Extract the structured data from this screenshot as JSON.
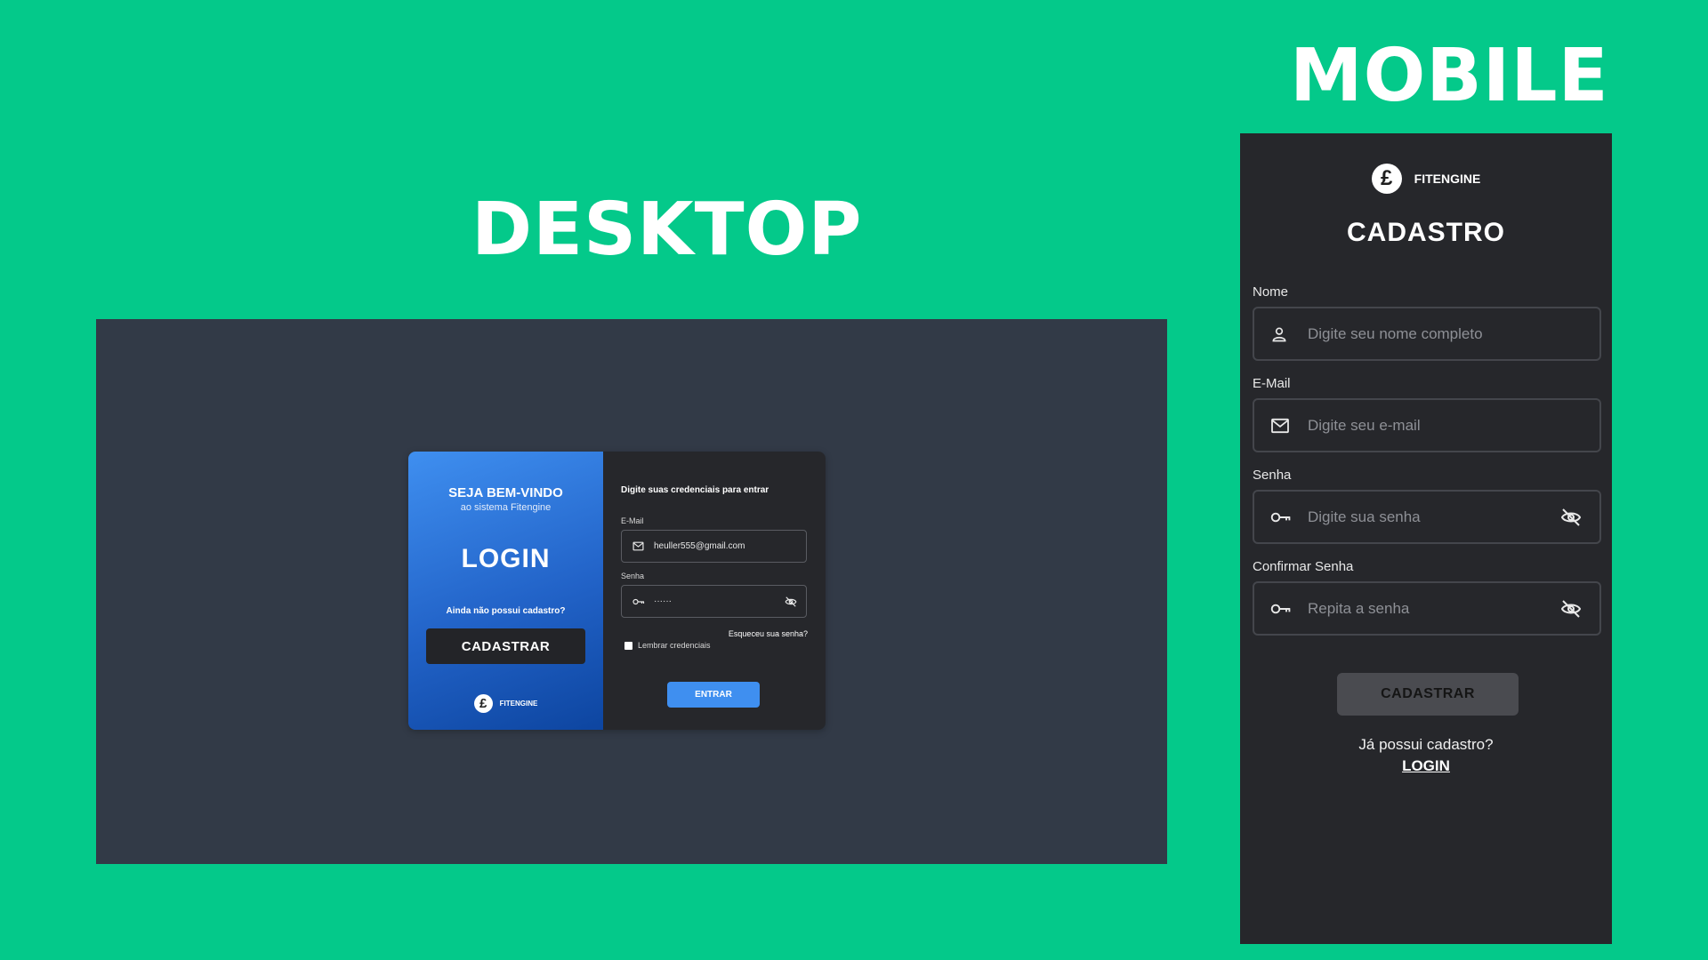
{
  "headings": {
    "desktop": "DESKTOP",
    "mobile": "MOBILE"
  },
  "colors": {
    "background": "#04c98a",
    "accent_blue": "#3f8ff0",
    "panel_dark": "#26272b",
    "desktop_bg": "#323a47"
  },
  "desktop": {
    "left_panel": {
      "welcome_title": "SEJA BEM-VINDO",
      "welcome_sub": "ao sistema Fitengine",
      "login_title": "LOGIN",
      "no_account": "Ainda não possui cadastro?",
      "signup_button": "CADASTRAR",
      "brand_logo": "£",
      "brand_name": "FITENGINE"
    },
    "right_panel": {
      "title": "Digite suas credenciais para entrar",
      "email_label": "E-Mail",
      "email_value": "heuller555@gmail.com",
      "email_icon": "mail-icon",
      "password_label": "Senha",
      "password_value": "······",
      "password_icon": "key-icon",
      "eye_icon": "eye-off-icon",
      "forgot": "Esqueceu sua senha?",
      "remember": "Lembrar credenciais",
      "enter_button": "ENTRAR"
    }
  },
  "mobile": {
    "brand_logo": "£",
    "brand_name": "FITENGINE",
    "title": "CADASTRO",
    "fields": {
      "name": {
        "label": "Nome",
        "placeholder": "Digite seu nome completo",
        "icon": "user-icon"
      },
      "email": {
        "label": "E-Mail",
        "placeholder": "Digite seu e-mail",
        "icon": "mail-icon"
      },
      "password": {
        "label": "Senha",
        "placeholder": "Digite sua senha",
        "icon": "key-icon"
      },
      "confirm": {
        "label": "Confirmar Senha",
        "placeholder": "Repita a senha",
        "icon": "key-icon"
      }
    },
    "signup_button": "CADASTRAR",
    "has_account": "Já possui cadastro?",
    "login_link": "LOGIN"
  }
}
